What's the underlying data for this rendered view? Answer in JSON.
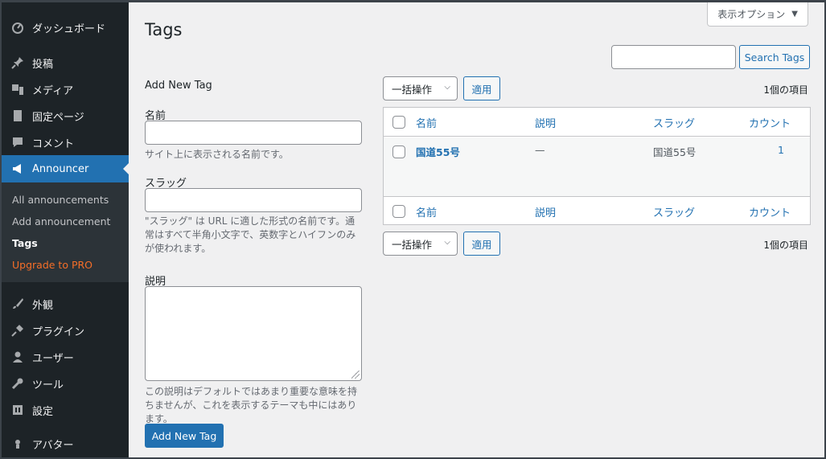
{
  "sidebar": {
    "items": [
      {
        "label": "ダッシュボード",
        "icon": "dashboard-icon"
      },
      {
        "label": "投稿",
        "icon": "pushpin-icon"
      },
      {
        "label": "メディア",
        "icon": "media-icon"
      },
      {
        "label": "固定ページ",
        "icon": "page-icon"
      },
      {
        "label": "コメント",
        "icon": "comment-icon"
      },
      {
        "label": "Announcer",
        "icon": "megaphone-icon"
      },
      {
        "label": "外観",
        "icon": "brush-icon"
      },
      {
        "label": "プラグイン",
        "icon": "plugin-icon"
      },
      {
        "label": "ユーザー",
        "icon": "user-icon"
      },
      {
        "label": "ツール",
        "icon": "wrench-icon"
      },
      {
        "label": "設定",
        "icon": "settings-icon"
      },
      {
        "label": "アバター",
        "icon": "avatar-icon"
      }
    ],
    "submenu": [
      "All announcements",
      "Add announcement",
      "Tags",
      "Upgrade to PRO"
    ]
  },
  "header": {
    "screen_options": "表示オプション",
    "title": "Tags",
    "search_button": "Search Tags"
  },
  "form": {
    "heading": "Add New Tag",
    "name_label": "名前",
    "name_help": "サイト上に表示される名前です。",
    "slug_label": "スラッグ",
    "slug_help": "\"スラッグ\" は URL に適した形式の名前です。通常はすべて半角小文字で、英数字とハイフンのみが使われます。",
    "desc_label": "説明",
    "desc_help": "この説明はデフォルトではあまり重要な意味を持ちませんが、これを表示するテーマも中にはあります。",
    "submit": "Add New Tag"
  },
  "list": {
    "bulk_label": "一括操作",
    "apply_label": "適用",
    "count": "1個の項目",
    "columns": {
      "name": "名前",
      "description": "説明",
      "slug": "スラッグ",
      "count": "カウント"
    },
    "rows": [
      {
        "name": "国道55号",
        "description": "—",
        "slug": "国道55号",
        "count": "1"
      }
    ]
  },
  "colors": {
    "accent": "#2271b1",
    "sidebar": "#1d2327",
    "submenu": "#2c3338",
    "pro": "#f56e28"
  }
}
